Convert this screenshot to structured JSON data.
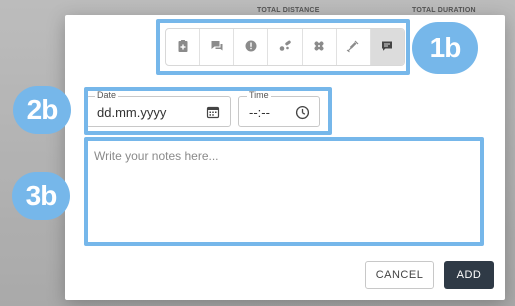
{
  "background": {
    "header_total_distance": "TOTAL DISTANCE",
    "header_total_duration": "TOTAL DURATION"
  },
  "callouts": {
    "toolbar_badge": "1b",
    "datetime_badge": "2b",
    "notes_badge": "3b",
    "color": "#76b7ea"
  },
  "toolbar": {
    "buttons": [
      {
        "icon": "clipboard-plus-icon",
        "active": false
      },
      {
        "icon": "chat-bubbles-icon",
        "active": false
      },
      {
        "icon": "alert-circle-icon",
        "active": false
      },
      {
        "icon": "pills-icon",
        "active": false
      },
      {
        "icon": "bandage-icon",
        "active": false
      },
      {
        "icon": "syringe-icon",
        "active": false
      },
      {
        "icon": "comment-icon",
        "active": true
      }
    ]
  },
  "date_field": {
    "label": "Date",
    "value": "dd.mm.yyyy",
    "icon": "calendar-icon"
  },
  "time_field": {
    "label": "Time",
    "value": "--:--",
    "icon": "clock-icon"
  },
  "notes": {
    "placeholder": "Write your notes here..."
  },
  "actions": {
    "cancel_label": "CANCEL",
    "add_label": "ADD",
    "add_color": "#2f3a46"
  }
}
